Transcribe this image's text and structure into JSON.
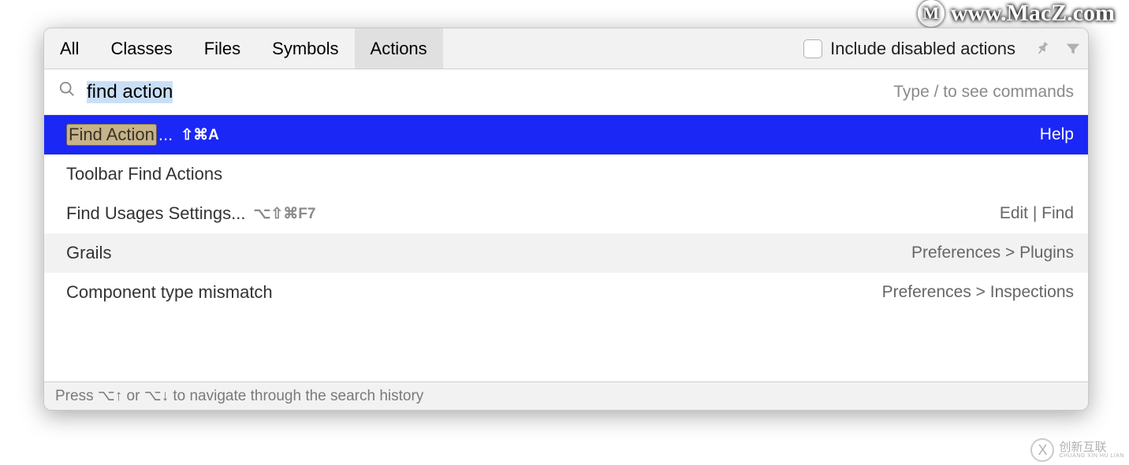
{
  "tabs": {
    "all": "All",
    "classes": "Classes",
    "files": "Files",
    "symbols": "Symbols",
    "actions": "Actions"
  },
  "include": {
    "label": "Include disabled actions",
    "checked": false
  },
  "search": {
    "query": "find action",
    "hint": "Type / to see commands"
  },
  "results": [
    {
      "label_highlight": "Find Action",
      "label_suffix": "...",
      "shortcut": "⇧⌘A",
      "location": "Help",
      "selected": true
    },
    {
      "label": "Toolbar Find Actions",
      "shortcut": "",
      "location": ""
    },
    {
      "label": "Find Usages Settings...",
      "shortcut": "⌥⇧⌘F7",
      "location": "Edit | Find"
    },
    {
      "label": "Grails",
      "shortcut": "",
      "location": "Preferences > Plugins"
    },
    {
      "label": "Component type mismatch",
      "shortcut": "",
      "location": "Preferences > Inspections"
    }
  ],
  "footer": "Press ⌥↑ or ⌥↓ to navigate through the search history",
  "watermarks": {
    "top": "www.MacZ.com",
    "top_icon": "M",
    "bottom_icon": "X",
    "bottom_zh": "创新互联",
    "bottom_en": "CHUANG XIN HU LIAN"
  }
}
